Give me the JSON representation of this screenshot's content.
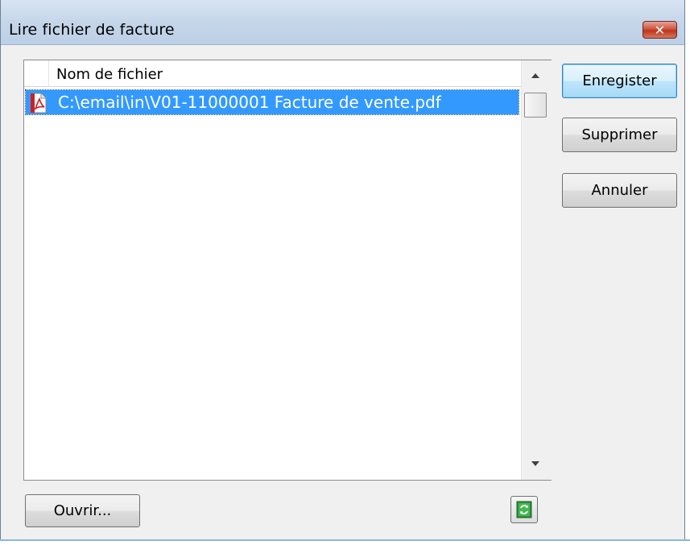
{
  "window": {
    "title": "Lire fichier de facture",
    "close_label": "✕"
  },
  "list": {
    "column_header": "Nom de fichier",
    "rows": [
      {
        "filename": "C:\\email\\in\\V01-11000001 Facture de vente.pdf",
        "icon": "pdf-file-icon",
        "selected": true
      }
    ]
  },
  "buttons": {
    "save": "Enregister",
    "delete": "Supprimer",
    "cancel": "Annuler",
    "open": "Ouvrir..."
  },
  "icons": {
    "refresh": "refresh-icon",
    "close": "close-icon"
  },
  "colors": {
    "selection": "#3399ff",
    "titlebar": "#c4d5e9",
    "close_button": "#c8462c",
    "background": "#f0f0f0"
  }
}
